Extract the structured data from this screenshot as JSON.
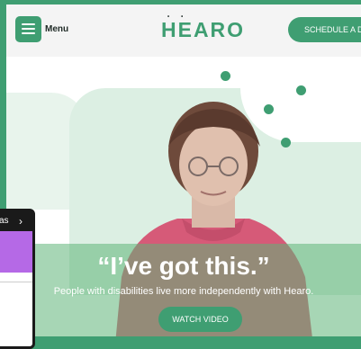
{
  "header": {
    "menu_label": "Menu",
    "logo_text": "HEARO",
    "cta_label": "SCHEDULE A DEMO"
  },
  "hero": {
    "quote": "“I’ve got this.”",
    "subtitle": "People with disabilities live more independently with Hearo.",
    "watch_label": "WATCH VIDEO"
  },
  "phone": {
    "top_text": "as"
  },
  "colors": {
    "brand_green": "#3f9e72",
    "soft_green": "#dcefe3",
    "phone_accent": "#b569e6"
  },
  "icons": [
    "hamburger-icon",
    "chevron-right-icon"
  ]
}
